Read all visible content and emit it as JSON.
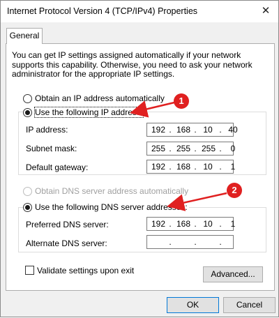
{
  "window": {
    "title": "Internet Protocol Version 4 (TCP/IPv4) Properties",
    "close_glyph": "✕"
  },
  "tabs": [
    {
      "label": "General",
      "active": true
    }
  ],
  "intro_text": "You can get IP settings assigned automatically if your network supports this capability. Otherwise, you need to ask your network administrator for the appropriate IP settings.",
  "ip_section": {
    "auto_label": "Obtain an IP address automatically",
    "manual_label": "Use the following IP address:",
    "selected": "manual",
    "fields": [
      {
        "label": "IP address:",
        "value": [
          "192",
          "168",
          "10",
          "40"
        ]
      },
      {
        "label": "Subnet mask:",
        "value": [
          "255",
          "255",
          "255",
          "0"
        ]
      },
      {
        "label": "Default gateway:",
        "value": [
          "192",
          "168",
          "10",
          "1"
        ]
      }
    ]
  },
  "dns_section": {
    "auto_label": "Obtain DNS server address automatically",
    "manual_label": "Use the following DNS server addresses:",
    "selected": "manual",
    "fields": [
      {
        "label": "Preferred DNS server:",
        "value": [
          "192",
          "168",
          "10",
          "1"
        ]
      },
      {
        "label": "Alternate DNS server:",
        "value": [
          "",
          "",
          "",
          ""
        ]
      }
    ]
  },
  "validate_label": "Validate settings upon exit",
  "validate_checked": false,
  "buttons": {
    "advanced": "Advanced...",
    "ok": "OK",
    "cancel": "Cancel"
  },
  "annotations": [
    {
      "number": "1",
      "color": "#e02020"
    },
    {
      "number": "2",
      "color": "#e02020"
    }
  ],
  "ip_separator": "."
}
